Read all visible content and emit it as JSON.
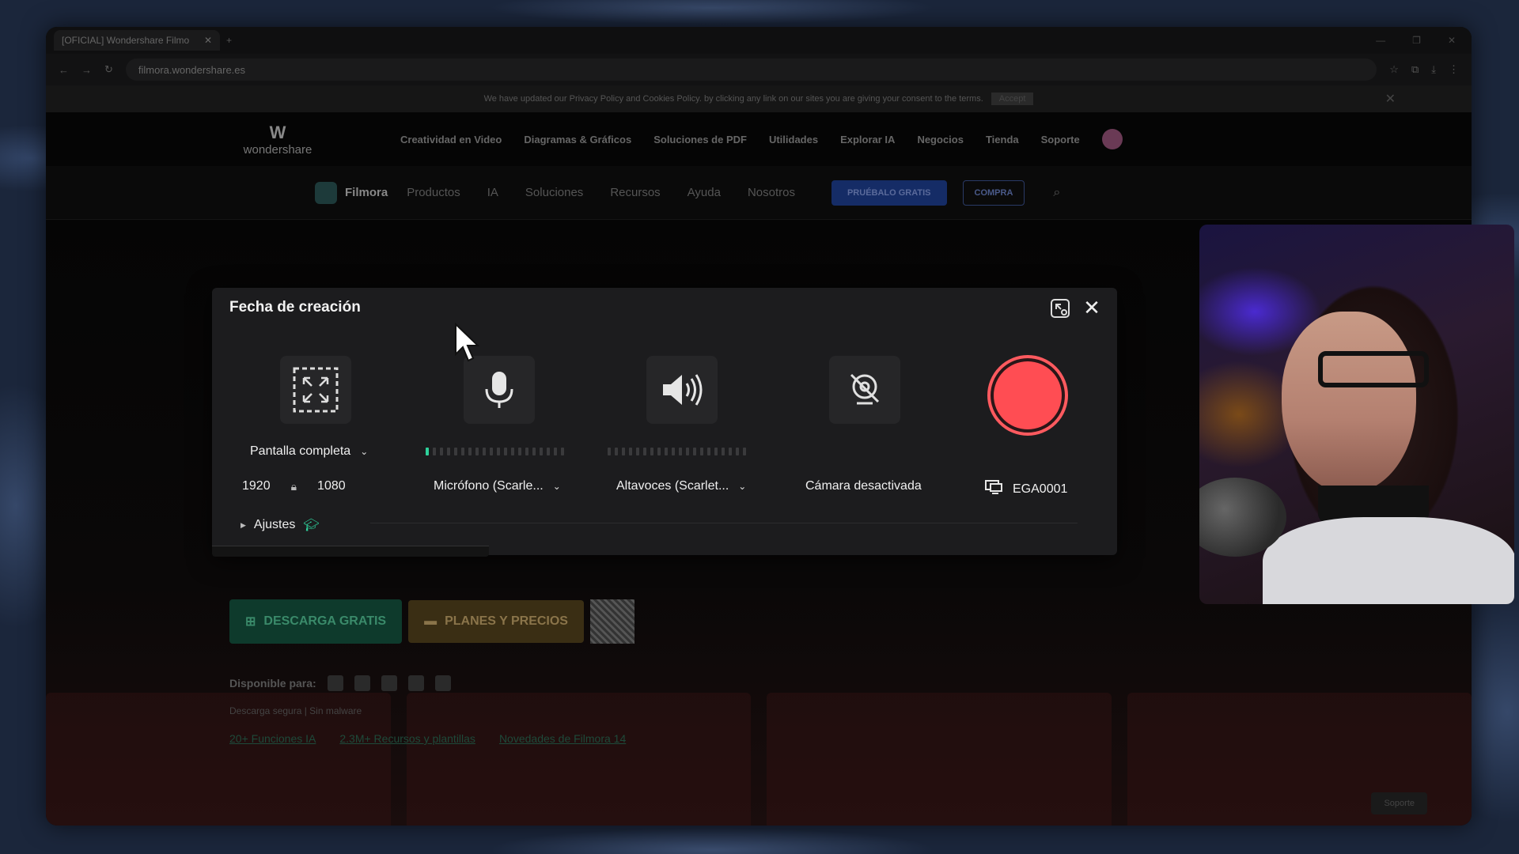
{
  "browser": {
    "tab_title": "[OFICIAL] Wondershare Filmo",
    "url": "filmora.wondershare.es",
    "cookie_text": "We have updated our Privacy Policy and Cookies Policy. by clicking any link on our sites you are giving your consent to the terms.",
    "cookie_accept": "Accept"
  },
  "site": {
    "logo_text": "wondershare",
    "top_nav": [
      "Creatividad en Video",
      "Diagramas & Gráficos",
      "Soluciones de PDF",
      "Utilidades",
      "Explorar IA",
      "Negocios",
      "Tienda",
      "Soporte"
    ],
    "brand": "Filmora",
    "sub_nav": [
      "Productos",
      "IA",
      "Soluciones",
      "Recursos",
      "Ayuda",
      "Nosotros"
    ],
    "try_label": "PRUÉBALO GRATIS",
    "buy_label": "COMPRA",
    "download_label": "DESCARGA GRATIS",
    "plans_label": "PLANES Y PRECIOS",
    "available_label": "Disponible para:",
    "secure_text": "Descarga segura | Sin malware",
    "links": [
      "20+ Funciones IA",
      "2.3M+ Recursos y plantillas",
      "Novedades de Filmora 14"
    ],
    "support_label": "Soporte"
  },
  "recorder": {
    "title": "Fecha de creación",
    "capture_mode": "Pantalla completa",
    "width": "1920",
    "height": "1080",
    "microphone": "Micrófono (Scarle...",
    "speakers": "Altavoces (Scarlet...",
    "camera": "Cámara desactivada",
    "display": "EGA0001",
    "settings_label": "Ajustes",
    "mic_level": 0.07,
    "speaker_level": 0.0,
    "accent_color": "#2ed19b",
    "record_color": "#ff4d53"
  }
}
